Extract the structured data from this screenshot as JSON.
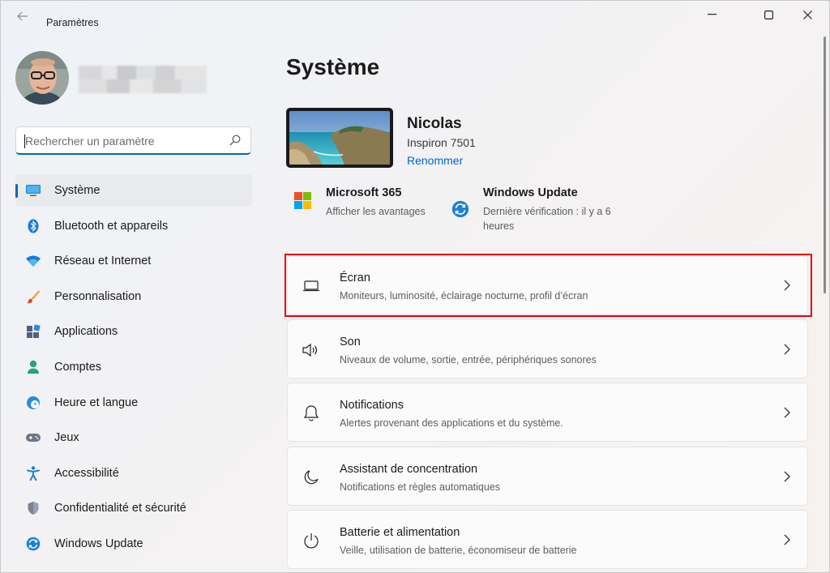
{
  "window": {
    "title": "Paramètres"
  },
  "search": {
    "placeholder": "Rechercher un paramètre"
  },
  "sidebar": {
    "items": [
      {
        "label": "Système",
        "icon": "monitor-icon",
        "active": true
      },
      {
        "label": "Bluetooth et appareils",
        "icon": "bluetooth-icon"
      },
      {
        "label": "Réseau et Internet",
        "icon": "wifi-icon"
      },
      {
        "label": "Personnalisation",
        "icon": "brush-icon"
      },
      {
        "label": "Applications",
        "icon": "apps-icon"
      },
      {
        "label": "Comptes",
        "icon": "account-icon"
      },
      {
        "label": "Heure et langue",
        "icon": "clock-globe-icon"
      },
      {
        "label": "Jeux",
        "icon": "gamepad-icon"
      },
      {
        "label": "Accessibilité",
        "icon": "accessibility-icon"
      },
      {
        "label": "Confidentialité et sécurité",
        "icon": "shield-icon"
      },
      {
        "label": "Windows Update",
        "icon": "update-icon"
      }
    ]
  },
  "main": {
    "title": "Système",
    "device": {
      "name": "Nicolas",
      "model": "Inspiron 7501",
      "rename": "Renommer"
    },
    "tiles": [
      {
        "title": "Microsoft 365",
        "subtitle": "Afficher les avantages",
        "icon": "microsoft-logo-icon"
      },
      {
        "title": "Windows Update",
        "subtitle": "Dernière vérification : il y a 6 heures",
        "icon": "update-icon"
      }
    ],
    "cards": [
      {
        "title": "Écran",
        "subtitle": "Moniteurs, luminosité, éclairage nocturne, profil d’écran",
        "icon": "display-icon",
        "highlighted": true
      },
      {
        "title": "Son",
        "subtitle": "Niveaux de volume, sortie, entrée, périphériques sonores",
        "icon": "speaker-icon"
      },
      {
        "title": "Notifications",
        "subtitle": "Alertes provenant des applications et du système.",
        "icon": "bell-icon"
      },
      {
        "title": "Assistant de concentration",
        "subtitle": "Notifications et règles automatiques",
        "icon": "moon-icon"
      },
      {
        "title": "Batterie et alimentation",
        "subtitle": "Veille, utilisation de batterie, économiseur de batterie",
        "icon": "power-icon"
      }
    ]
  },
  "colors": {
    "accent": "#0067c0",
    "highlight": "#e3000f"
  }
}
